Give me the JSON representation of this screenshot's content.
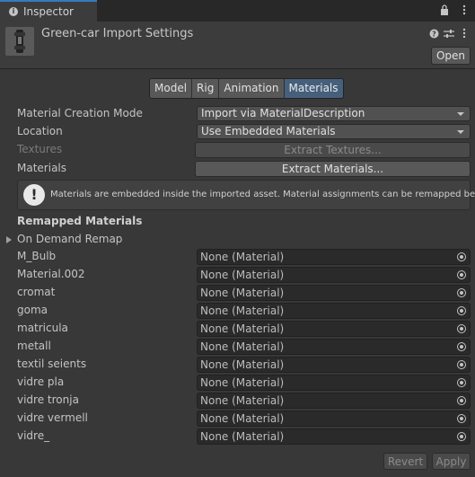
{
  "window": {
    "tab_title": "Inspector"
  },
  "header": {
    "title": "Green-car Import Settings",
    "open_label": "Open"
  },
  "tabs": [
    {
      "label": "Model",
      "active": false
    },
    {
      "label": "Rig",
      "active": false
    },
    {
      "label": "Animation",
      "active": false
    },
    {
      "label": "Materials",
      "active": true
    }
  ],
  "settings": {
    "creation_mode_label": "Material Creation Mode",
    "creation_mode_value": "Import via MaterialDescription",
    "location_label": "Location",
    "location_value": "Use Embedded Materials",
    "textures_label": "Textures",
    "extract_textures_label": "Extract Textures...",
    "materials_label": "Materials",
    "extract_materials_label": "Extract Materials..."
  },
  "help": {
    "icon": "!",
    "text": "Materials are embedded inside the imported asset. Material assignments can be remapped below."
  },
  "remap": {
    "section_title": "Remapped Materials",
    "foldout_label": "On Demand Remap",
    "rows": [
      {
        "name": "M_Bulb",
        "value": "None (Material)"
      },
      {
        "name": "Material.002",
        "value": "None (Material)"
      },
      {
        "name": "cromat",
        "value": "None (Material)"
      },
      {
        "name": "goma",
        "value": "None (Material)"
      },
      {
        "name": "matricula",
        "value": "None (Material)"
      },
      {
        "name": "metall",
        "value": "None (Material)"
      },
      {
        "name": "textil seients",
        "value": "None (Material)"
      },
      {
        "name": "vidre  pla",
        "value": "None (Material)"
      },
      {
        "name": "vidre tronja",
        "value": "None (Material)"
      },
      {
        "name": "vidre vermell",
        "value": "None (Material)"
      },
      {
        "name": "vidre_",
        "value": "None (Material)"
      }
    ]
  },
  "footer": {
    "revert_label": "Revert",
    "apply_label": "Apply"
  },
  "icons": {
    "tab_icon": "info-icon",
    "lock": "lock-icon",
    "menu": "kebab-menu-icon",
    "help": "help-icon",
    "presets": "presets-icon",
    "object_picker": "object-picker-icon"
  }
}
